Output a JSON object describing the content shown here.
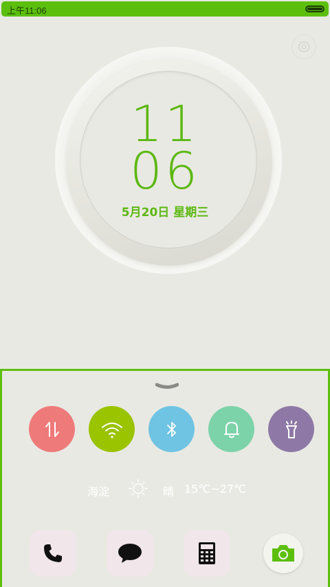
{
  "status_bar": {
    "time": "上午11:06"
  },
  "clock": {
    "hour": "11",
    "minute": "06",
    "date": "5月20日  星期三"
  },
  "toggles": [
    {
      "name": "mobile-data",
      "icon": "data-arrows-icon",
      "color": "#ef7a7a"
    },
    {
      "name": "wifi",
      "icon": "wifi-icon",
      "color": "#9ac300"
    },
    {
      "name": "bluetooth",
      "icon": "bluetooth-icon",
      "color": "#6fc3e3"
    },
    {
      "name": "sound",
      "icon": "bell-icon",
      "color": "#7dd3a9"
    },
    {
      "name": "flashlight",
      "icon": "flashlight-icon",
      "color": "#8e79a6"
    }
  ],
  "weather": {
    "location": "海淀",
    "condition": "晴",
    "temperature": "15℃~27℃"
  },
  "dock": [
    {
      "name": "phone",
      "icon": "phone-icon"
    },
    {
      "name": "messages",
      "icon": "chat-bubble-icon"
    },
    {
      "name": "calculator",
      "icon": "calculator-icon"
    },
    {
      "name": "camera",
      "icon": "camera-icon",
      "accent": "#5cbf0e"
    }
  ],
  "colors": {
    "accent": "#5cbf0e",
    "clock_text": "#5cb811",
    "background": "#e9e9e3"
  }
}
